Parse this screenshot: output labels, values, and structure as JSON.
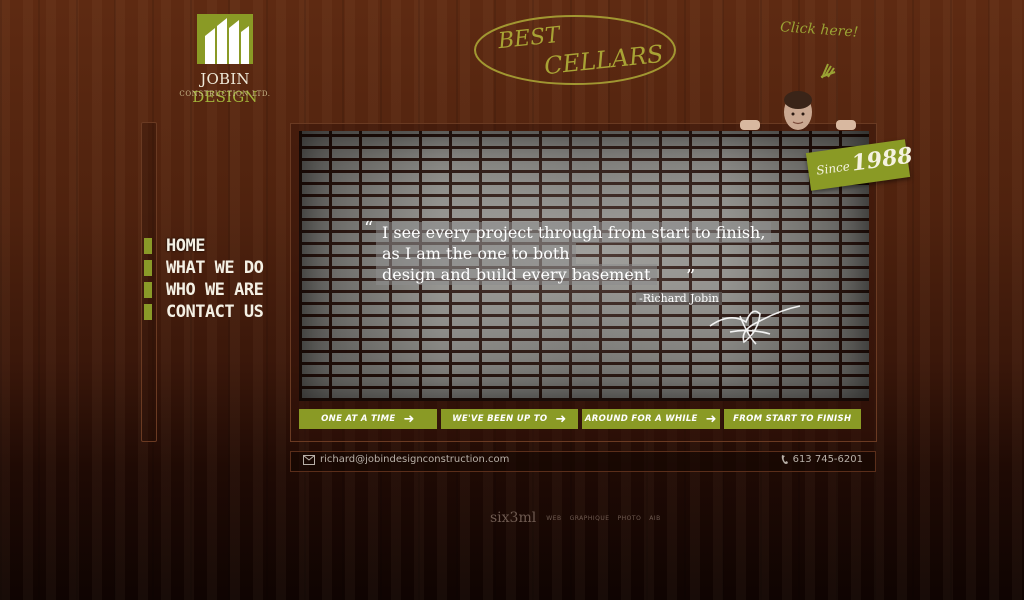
{
  "logo": {
    "name_part1": "JOBIN",
    "name_part2": "DESIGN",
    "sub": "CONSTRUCTION LTD."
  },
  "header": {
    "best": "BEST",
    "cellars": "CELLARS",
    "click_here": "Click here!"
  },
  "nav": {
    "items": [
      {
        "label": "HOME"
      },
      {
        "label": "WHAT WE DO"
      },
      {
        "label": "WHO WE ARE"
      },
      {
        "label": "CONTACT US"
      }
    ]
  },
  "quote": {
    "line1": "I see every project through from start to finish,",
    "line2": "as I am the one to both",
    "line3": "design and build every basement",
    "author": "-Richard Jobin"
  },
  "badge": {
    "since": "Since",
    "year": "1988"
  },
  "tabs": [
    {
      "label": "one at a time"
    },
    {
      "label": "we've been up to"
    },
    {
      "label": "around for a while"
    },
    {
      "label": "from start to finish"
    }
  ],
  "contact": {
    "email": "richard@jobindesignconstruction.com",
    "phone": "613 745-6201"
  },
  "footer": {
    "brand": "six3ml",
    "links": [
      "WEB",
      "GRAPHIQUE",
      "PHOTO",
      "AIB"
    ]
  },
  "colors": {
    "accent_green": "#8a9a25",
    "wood": "#4f220e"
  },
  "icons": {
    "email": "email-icon",
    "phone": "phone-icon",
    "arrow": "arrow-right-icon"
  }
}
